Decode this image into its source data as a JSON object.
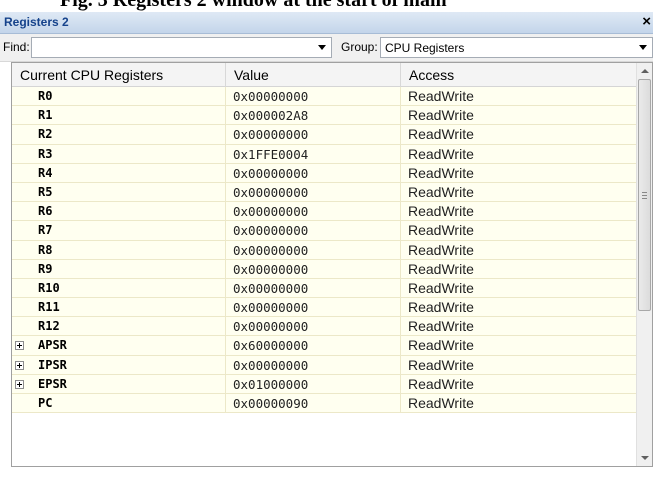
{
  "page_heading_cut": "Fig. 3 Registers 2 window at the start of main",
  "window": {
    "title": "Registers 2",
    "close_glyph": "×"
  },
  "toolbar": {
    "find_label": "Find:",
    "find_value": "",
    "group_label": "Group:",
    "group_value": "CPU Registers"
  },
  "columns": [
    "Current CPU Registers",
    "Value",
    "Access"
  ],
  "rows": [
    {
      "name": "R0",
      "value": "0x00000000",
      "access": "ReadWrite",
      "expandable": false
    },
    {
      "name": "R1",
      "value": "0x000002A8",
      "access": "ReadWrite",
      "expandable": false
    },
    {
      "name": "R2",
      "value": "0x00000000",
      "access": "ReadWrite",
      "expandable": false
    },
    {
      "name": "R3",
      "value": "0x1FFE0004",
      "access": "ReadWrite",
      "expandable": false
    },
    {
      "name": "R4",
      "value": "0x00000000",
      "access": "ReadWrite",
      "expandable": false
    },
    {
      "name": "R5",
      "value": "0x00000000",
      "access": "ReadWrite",
      "expandable": false
    },
    {
      "name": "R6",
      "value": "0x00000000",
      "access": "ReadWrite",
      "expandable": false
    },
    {
      "name": "R7",
      "value": "0x00000000",
      "access": "ReadWrite",
      "expandable": false
    },
    {
      "name": "R8",
      "value": "0x00000000",
      "access": "ReadWrite",
      "expandable": false
    },
    {
      "name": "R9",
      "value": "0x00000000",
      "access": "ReadWrite",
      "expandable": false
    },
    {
      "name": "R10",
      "value": "0x00000000",
      "access": "ReadWrite",
      "expandable": false
    },
    {
      "name": "R11",
      "value": "0x00000000",
      "access": "ReadWrite",
      "expandable": false
    },
    {
      "name": "R12",
      "value": "0x00000000",
      "access": "ReadWrite",
      "expandable": false
    },
    {
      "name": "APSR",
      "value": "0x60000000",
      "access": "ReadWrite",
      "expandable": true
    },
    {
      "name": "IPSR",
      "value": "0x00000000",
      "access": "ReadWrite",
      "expandable": true
    },
    {
      "name": "EPSR",
      "value": "0x01000000",
      "access": "ReadWrite",
      "expandable": true
    },
    {
      "name": "PC",
      "value": "0x00000090",
      "access": "ReadWrite",
      "expandable": false
    }
  ],
  "icons": {
    "close": "close-icon",
    "dropdown": "chevron-down-icon",
    "expand": "plus-box-icon",
    "scroll_up": "arrow-up-icon",
    "scroll_down": "arrow-down-icon"
  }
}
